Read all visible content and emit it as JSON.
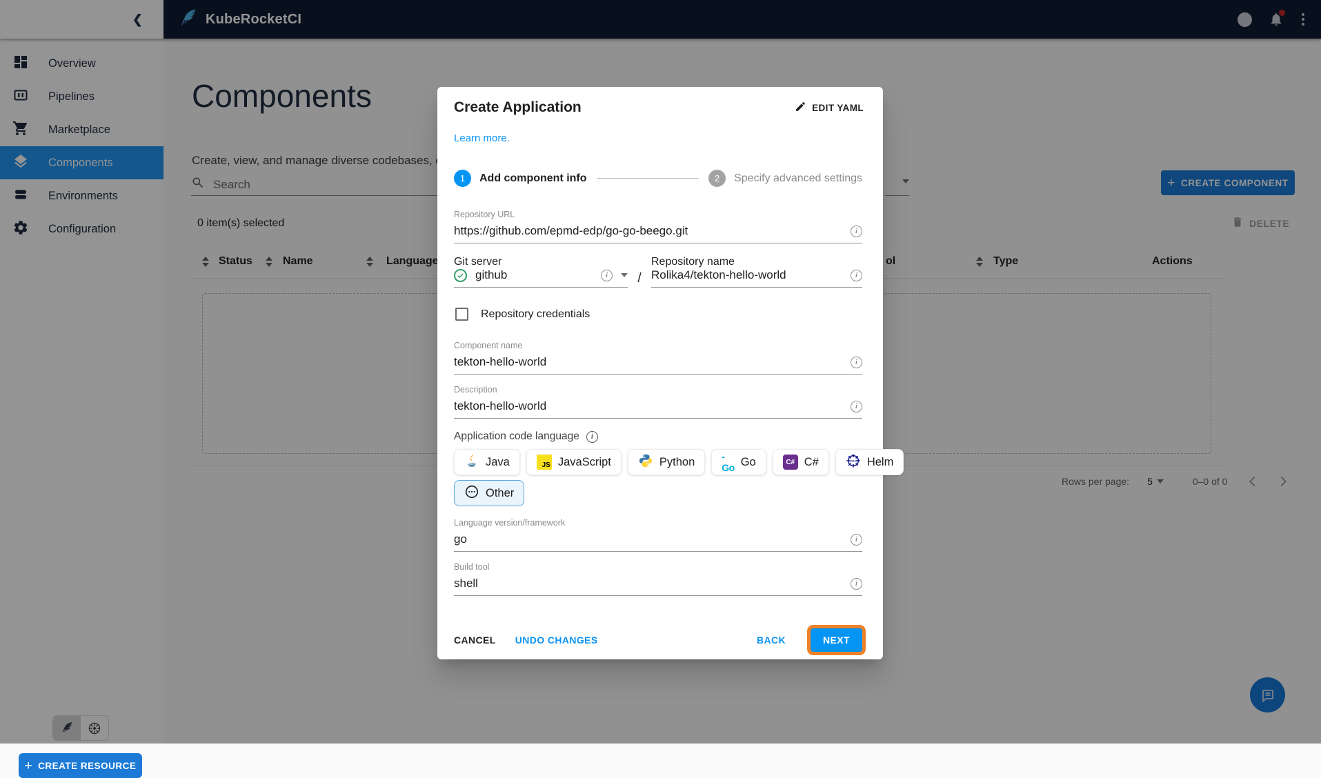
{
  "topbar": {
    "app_title": "KubeRocketCI",
    "icons": [
      "feather-logo-icon",
      "info-icon",
      "notifications-bell-icon",
      "kebab-menu-icon"
    ]
  },
  "sidebar": {
    "items": [
      {
        "label": "Overview",
        "icon": "dashboard-icon",
        "selected": false
      },
      {
        "label": "Pipelines",
        "icon": "pipelines-icon",
        "selected": false
      },
      {
        "label": "Marketplace",
        "icon": "cart-icon",
        "selected": false
      },
      {
        "label": "Components",
        "icon": "layers-icon",
        "selected": true
      },
      {
        "label": "Environments",
        "icon": "stack-icon",
        "selected": false
      },
      {
        "label": "Configuration",
        "icon": "gear-icon",
        "selected": false
      }
    ],
    "create_resource_label": "CREATE RESOURCE"
  },
  "page": {
    "title": "Components",
    "subtitle_visible": "Create, view, and manage diverse codebases, enco",
    "search_placeholder": "Search",
    "selected_count": "0 item(s) selected",
    "delete_label": "DELETE",
    "create_component_label": "CREATE COMPONENT",
    "table": {
      "columns": [
        {
          "label": "Status"
        },
        {
          "label": "Name"
        },
        {
          "label": "Language"
        },
        {
          "label": "ol"
        },
        {
          "label": "Type"
        },
        {
          "label": "Actions"
        }
      ]
    },
    "pagination": {
      "rows_per_page_label": "Rows per page:",
      "rows_per_page_value": "5",
      "range": "0–0 of 0"
    }
  },
  "modal": {
    "title": "Create Application",
    "edit_yaml_label": "EDIT YAML",
    "learn_more_label": "Learn more.",
    "stepper": {
      "step1_number": "1",
      "step1_label": "Add component info",
      "step2_number": "2",
      "step2_label": "Specify advanced settings"
    },
    "fields": {
      "repository_url": {
        "label": "Repository URL",
        "value": "https://github.com/epmd-edp/go-go-beego.git"
      },
      "git_server": {
        "label": "Git server",
        "value": "github"
      },
      "separator": "/",
      "repository_name": {
        "label": "Repository name",
        "value": "Rolika4/tekton-hello-world"
      },
      "repository_credentials_label": "Repository credentials",
      "component_name": {
        "label": "Component name",
        "value": "tekton-hello-world"
      },
      "description": {
        "label": "Description",
        "value": "tekton-hello-world"
      },
      "code_language_label": "Application code language",
      "language_version": {
        "label": "Language version/framework",
        "value": "go"
      },
      "build_tool": {
        "label": "Build tool",
        "value": "shell"
      }
    },
    "languages": [
      {
        "label": "Java",
        "icon": "java-icon",
        "selected": false
      },
      {
        "label": "JavaScript",
        "icon": "javascript-icon",
        "selected": false
      },
      {
        "label": "Python",
        "icon": "python-icon",
        "selected": false
      },
      {
        "label": "Go",
        "icon": "go-icon",
        "selected": false
      },
      {
        "label": "C#",
        "icon": "csharp-icon",
        "selected": false
      },
      {
        "label": "Helm",
        "icon": "helm-icon",
        "selected": false
      },
      {
        "label": "Other",
        "icon": "other-dots-icon",
        "selected": true
      }
    ],
    "actions": {
      "cancel": "CANCEL",
      "undo": "UNDO CHANGES",
      "back": "BACK",
      "next": "NEXT"
    }
  },
  "colors": {
    "primary_blue": "#0394f4",
    "button_blue": "#1c7ad6",
    "topbar_bg": "#101c33",
    "sidebar_selected": "#2196f3",
    "highlight_orange": "#ef8228",
    "link_blue": "#0a93f5",
    "chip_selected_bg": "#e9f4fd",
    "chip_selected_border": "#5ba8dd",
    "notification_red": "#c62828"
  }
}
